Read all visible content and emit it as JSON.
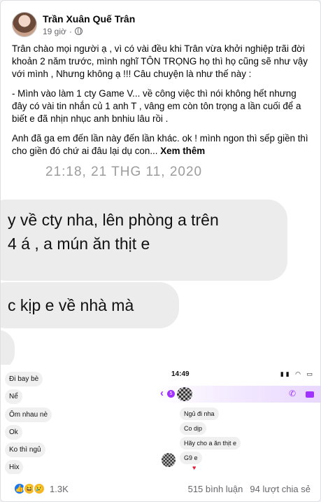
{
  "post": {
    "author": "Trần Xuân Quế Trân",
    "time": "19 giờ",
    "paragraphs": [
      "Trân chào mọi người ạ , vì có vài đều khi Trân vừa khởi nghiệp trãi đời khoản 2 năm trước, mình nghĩ TÔN TRỌNG họ thì họ cũng sẽ như vậy với mình , Nhưng không ạ !!! Câu chuyện là như thế này :",
      "- Mình vào làm 1 cty Game V... về công việc thì nói không hết nhưng đây có vài tin nhắn củ 1 anh T , vâng em còn tôn trọng a lần cuối để a biết e đã nhịn nhục anh bnhiu lâu rồi .",
      "Anh đã ga em đến lần này đến lần khác. ok ! mình ngon thì sếp giền thì cho giền đó chứ ai đâu lại dụ con..."
    ],
    "see_more": "Xem thêm"
  },
  "image1": {
    "timestamp": "21:18, 21 THG 11, 2020",
    "bubble1_line1": "y về cty nha, lên phòng a trên",
    "bubble1_line2": "4 á , a mún ăn thịt e",
    "bubble2": "c kịp e về nhà mà"
  },
  "image2": {
    "left_messages": [
      "Đi bay bè",
      "Nể",
      "Ôm nhau nè",
      "Ok",
      "Ko thì ngủ",
      "Hix"
    ],
    "status_time": "14:49",
    "badge": "5",
    "right_messages": [
      "Ngủ đi nha",
      "Co dịp",
      "Hãy cho a ăn thịt e",
      "G9 e"
    ],
    "heart": "♥"
  },
  "footer": {
    "reaction_count": "1.3K",
    "comments": "515 bình luận",
    "shares": "94 lượt chia sẻ"
  }
}
